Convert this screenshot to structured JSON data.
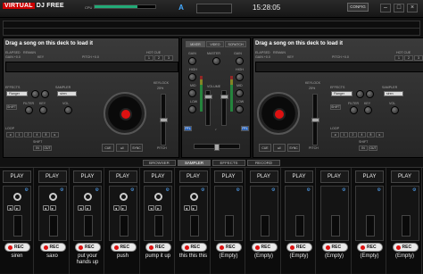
{
  "app": {
    "logo_brand": "VIRTUAL",
    "logo_name": "DJ FREE",
    "cpu_label": "CPU",
    "cpu_load": 0.7,
    "deck_letter": "A",
    "clock": "15:28:05",
    "config_label": "CONFIG",
    "min_label": "–",
    "max_label": "□",
    "close_label": "×"
  },
  "deck_left": {
    "title": "Drag a song on this deck to load it",
    "elapsed_label": "ELAPSED",
    "remain_label": "REMAIN",
    "gain_label": "GAIN +0.0",
    "key_label": "KEY",
    "pitch_label": "PITCH +0.0",
    "hotcue_label": "HOT CUE",
    "hotcues": [
      "1",
      "2",
      "3"
    ],
    "effects_label": "EFFECTS",
    "effect_value": "Flanger",
    "sampler_label": "SAMPLER",
    "sampler_value": "siren",
    "filter_label": "FILTER",
    "key_knob_label": "KEY",
    "vol_label": "VOL",
    "loop_label": "LOOP",
    "loop_values": [
      "◂",
      "1",
      "2",
      "4",
      "8",
      "▸"
    ],
    "shift_label": "SHIFT",
    "in_label": "IN",
    "out_label": "OUT",
    "keylock_label": "KEYLOCK",
    "keylock_value": "25%",
    "cue_label": "CUE",
    "play_label": "▸‖",
    "sync_label": "SYNC",
    "pitch_label2": "PITCH"
  },
  "deck_right": {
    "title": "Drag a song on this deck to load it",
    "elapsed_label": "ELAPSED",
    "remain_label": "REMAIN",
    "gain_label": "GAIN +0.0",
    "key_label": "KEY",
    "pitch_label": "PITCH +0.0",
    "hotcue_label": "HOT CUE",
    "hotcues": [
      "1",
      "2",
      "3"
    ],
    "effects_label": "EFFECTS",
    "effect_value": "Flanger",
    "sampler_label": "SAMPLER",
    "sampler_value": "siren",
    "filter_label": "FILTER",
    "key_knob_label": "KEY",
    "vol_label": "VOL",
    "loop_label": "LOOP",
    "loop_values": [
      "◂",
      "1",
      "2",
      "4",
      "8",
      "▸"
    ],
    "shift_label": "SHIFT",
    "in_label": "IN",
    "out_label": "OUT",
    "keylock_label": "KEYLOCK",
    "keylock_value": "25%",
    "cue_label": "CUE",
    "play_label": "▸‖",
    "sync_label": "SYNC",
    "pitch_label2": "PITCH"
  },
  "mixer": {
    "tabs": [
      "MIXER",
      "VIDEO",
      "SCRATCH"
    ],
    "gain_label": "GAIN",
    "master_label": "MASTER",
    "high_label": "HIGH",
    "mid_label": "MID",
    "low_label": "LOW",
    "volume_label": "VOLUME",
    "pfl_label": "PFL",
    "headphones_label": "♪"
  },
  "bottom_tabs": [
    "BROWSER",
    "SAMPLER",
    "EFFECTS",
    "RECORD"
  ],
  "active_tab": "SAMPLER",
  "sampler": {
    "play_label": "PLAY",
    "rec_label": "REC",
    "slots": [
      {
        "name": "siren",
        "loaded": true
      },
      {
        "name": "saxo",
        "loaded": true
      },
      {
        "name": "put your hands up",
        "loaded": true
      },
      {
        "name": "push",
        "loaded": true
      },
      {
        "name": "pump it up",
        "loaded": true
      },
      {
        "name": "this this this",
        "loaded": true
      },
      {
        "name": "(Empty)",
        "loaded": false
      },
      {
        "name": "(Empty)",
        "loaded": false
      },
      {
        "name": "(Empty)",
        "loaded": false
      },
      {
        "name": "(Empty)",
        "loaded": false
      },
      {
        "name": "(Empty)",
        "loaded": false
      },
      {
        "name": "(Empty)",
        "loaded": false
      }
    ]
  },
  "colors": {
    "accent": "#4aa8ff",
    "rec_dot": "#dd1111",
    "platter_center": "#dd1111"
  }
}
